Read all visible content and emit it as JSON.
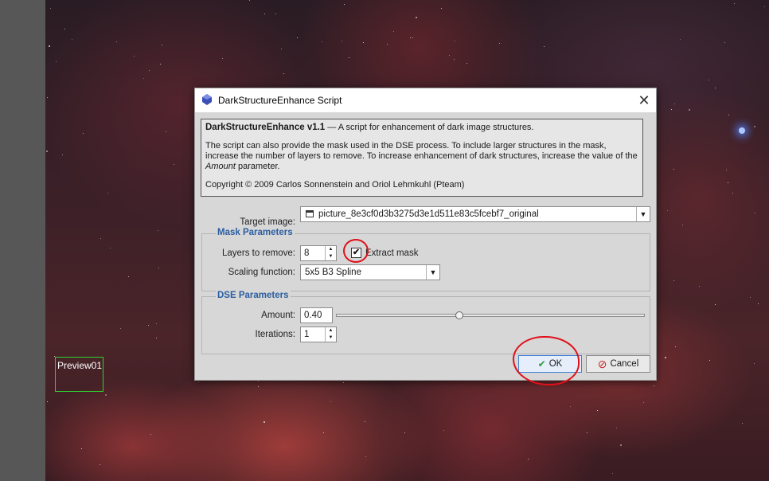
{
  "dialog": {
    "title": "DarkStructureEnhance Script",
    "close_glyph": "✕",
    "info": {
      "heading": "DarkStructureEnhance v1.1",
      "heading_rest": " — A script for enhancement of dark image structures.",
      "paragraph_pre": "The script can also provide the mask used in the DSE process. To include larger structures in the mask, increase the number of layers to remove. To increase enhancement of dark structures, increase the value of the ",
      "paragraph_em": "Amount",
      "paragraph_post": " parameter.",
      "copyright": "Copyright © 2009 Carlos Sonnenstein and Oriol Lehmkuhl (Pteam)"
    },
    "target_image": {
      "label": "Target image:",
      "value": "picture_8e3cf0d3b3275d3e1d511e83c5fcebf7_original"
    },
    "mask_parameters": {
      "title": "Mask Parameters",
      "layers_label": "Layers to remove:",
      "layers_value": "8",
      "extract_mask_label": "Extract mask",
      "extract_mask_checked": true,
      "check_glyph": "✔",
      "scaling_label": "Scaling function:",
      "scaling_value": "5x5 B3 Spline"
    },
    "dse_parameters": {
      "title": "DSE Parameters",
      "amount_label": "Amount:",
      "amount_value": "0.40",
      "amount_fraction": 0.4,
      "iterations_label": "Iterations:",
      "iterations_value": "1"
    },
    "buttons": {
      "ok_label": "OK",
      "cancel_label": "Cancel"
    }
  },
  "workspace": {
    "preview_label": "Preview01"
  },
  "icons": {
    "dropdown": "▼",
    "spin_up": "▲",
    "spin_down": "▼",
    "ok_check": "✔",
    "cancel": "⊘"
  },
  "colors": {
    "group_title": "#2b5ea0",
    "preview_border": "#2fd12f",
    "annotation_red": "#e0101a",
    "ok_check": "#2e9c3a",
    "cancel_red": "#c42727"
  }
}
